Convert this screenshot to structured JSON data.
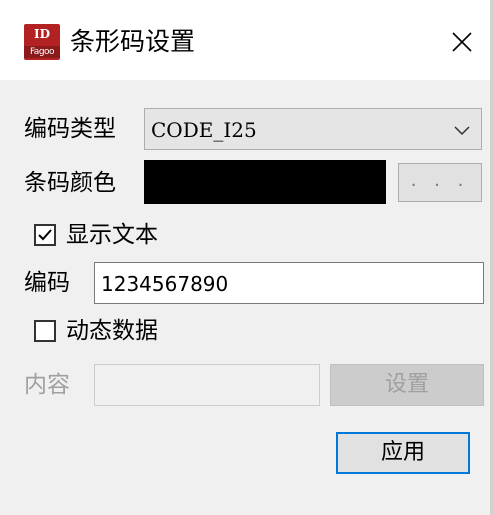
{
  "window": {
    "title": "条形码设置",
    "icon_name": "app-logo-icon",
    "icon_text_top": "ID",
    "icon_text_bottom": "Fagoo",
    "close_icon": "close-icon"
  },
  "form": {
    "encoding_type": {
      "label": "编码类型",
      "value": "CODE_I25"
    },
    "barcode_color": {
      "label": "条码颜色",
      "color": "#000000",
      "picker_button_label": ". . ."
    },
    "show_text": {
      "label": "显示文本",
      "checked": true
    },
    "code": {
      "label": "编码",
      "value": "1234567890"
    },
    "dynamic_data": {
      "label": "动态数据",
      "checked": false
    },
    "content": {
      "label": "内容",
      "value": "",
      "enabled": false,
      "set_button_label": "设置"
    }
  },
  "footer": {
    "apply_button_label": "应用"
  },
  "colors": {
    "dialog_background": "#f0f0f0",
    "titlebar_background": "#ffffff",
    "accent_border": "#0078d7",
    "disabled_text": "#a0a0a0"
  }
}
